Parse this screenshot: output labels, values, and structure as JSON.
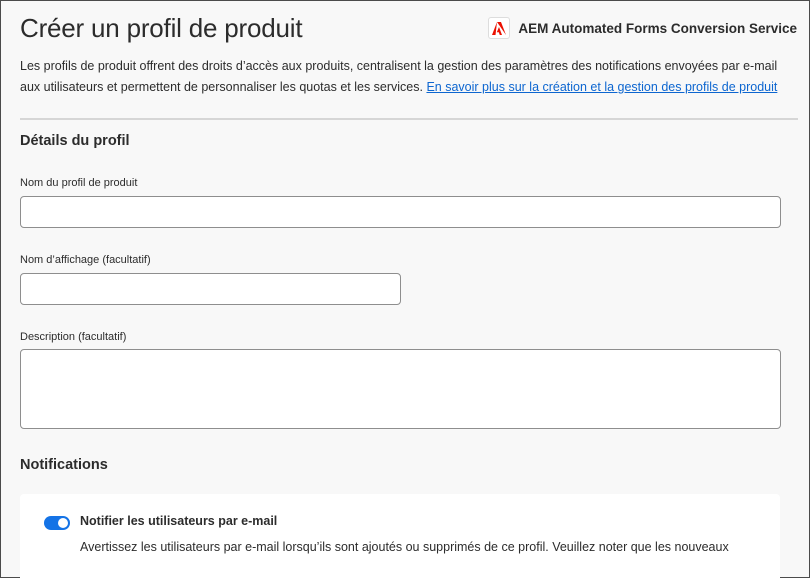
{
  "header": {
    "title": "Créer un profil de produit",
    "product_name": "AEM Automated Forms Conversion Service",
    "logo_icon": "adobe-logo-icon"
  },
  "intro": {
    "text": "Les profils de produit offrent des droits d’accès aux produits, centralisent la gestion des paramètres des notifications envoyées par e-mail aux utilisateurs et permettent de personnaliser les quotas et les services. ",
    "link": "En savoir plus sur la création et la gestion des profils de produit"
  },
  "profile_details": {
    "section_title": "Détails du profil",
    "product_profile_name": {
      "label": "Nom du profil de produit",
      "value": ""
    },
    "display_name": {
      "label": "Nom d’affichage (facultatif)",
      "value": ""
    },
    "description": {
      "label": "Description (facultatif)",
      "value": ""
    }
  },
  "notifications": {
    "section_title": "Notifications",
    "email_toggle": {
      "label": "Notifier les utilisateurs par e-mail",
      "enabled": true,
      "description": "Avertissez les utilisateurs par e-mail lorsqu’ils sont ajoutés ou supprimés de ce profil. Veuillez noter que les nouveaux"
    }
  },
  "colors": {
    "accent": "#1473e6",
    "link": "#0d66d0",
    "adobe_red": "#eb1000"
  }
}
